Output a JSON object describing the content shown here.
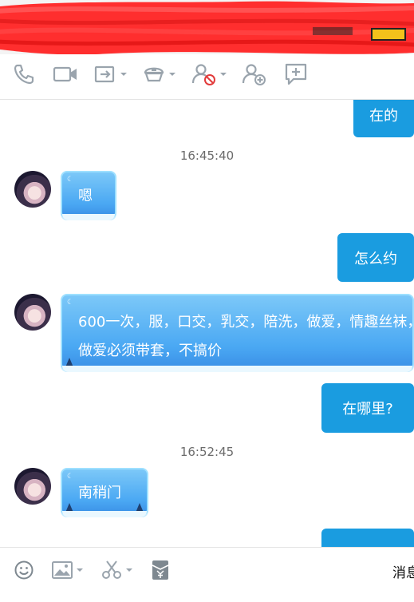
{
  "window": {
    "title": ""
  },
  "toolbar": {
    "icons": [
      "phone-icon",
      "video-icon",
      "share-screen-icon",
      "remote-assist-icon",
      "block-user-icon",
      "add-friend-icon",
      "message-icon"
    ]
  },
  "chat": {
    "messages": [
      {
        "side": "out",
        "text": "在的"
      },
      {
        "type": "timestamp",
        "text": "16:45:40"
      },
      {
        "side": "in",
        "text": "嗯"
      },
      {
        "side": "out",
        "text": "怎么约"
      },
      {
        "side": "in",
        "text": "600一次，服，口交，乳交，陪洗，做爱，情趣丝袜，做爱必须带套，不搞价"
      },
      {
        "side": "out",
        "text": "在哪里?"
      },
      {
        "type": "timestamp",
        "text": "16:52:45"
      },
      {
        "side": "in",
        "text": "南稍门"
      },
      {
        "side": "out",
        "text": ""
      }
    ]
  },
  "bottombar": {
    "icons": [
      "emoji-icon",
      "image-icon",
      "scissors-icon",
      "red-packet-icon"
    ],
    "message_label": "消息"
  },
  "colors": {
    "outgoing_bubble": "#1a9ce0",
    "incoming_bubble": "#4aa8f3",
    "scribble": "#ff2a2a"
  }
}
